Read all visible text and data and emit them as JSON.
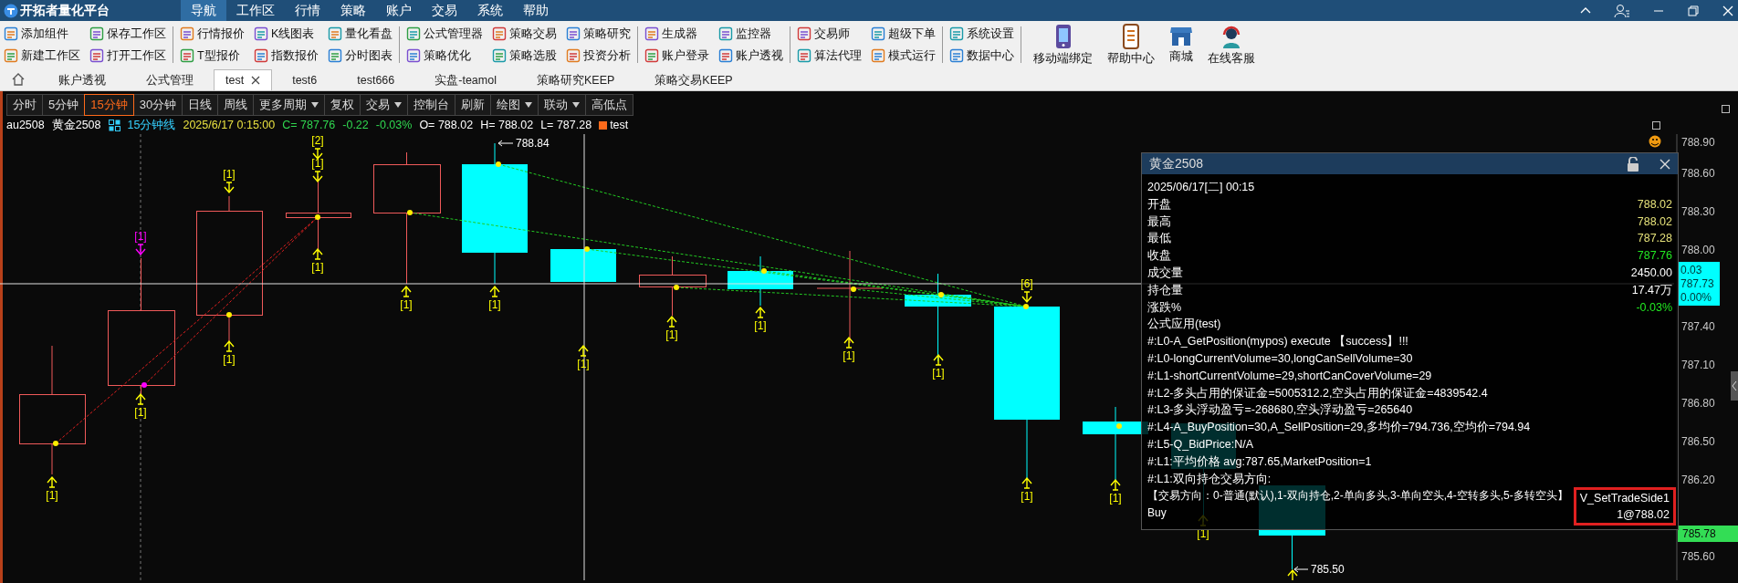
{
  "window": {
    "title": "开拓者量化平台"
  },
  "menu": [
    {
      "label": "导航",
      "selected": true
    },
    {
      "label": "工作区",
      "selected": false
    },
    {
      "label": "行情",
      "selected": false
    },
    {
      "label": "策略",
      "selected": false
    },
    {
      "label": "账户",
      "selected": false
    },
    {
      "label": "交易",
      "selected": false
    },
    {
      "label": "系统",
      "selected": false
    },
    {
      "label": "帮助",
      "selected": false
    }
  ],
  "toolbar": {
    "groups": [
      {
        "items": [
          "添加组件",
          "新建工作区",
          "保存工作区",
          "打开工作区"
        ]
      },
      {
        "items": [
          "行情报价",
          "T型报价",
          "K线图表",
          "指数报价",
          "量化看盘",
          "分时图表"
        ]
      },
      {
        "items": [
          "公式管理器",
          "策略优化",
          "策略交易",
          "策略选股",
          "策略研究",
          "投资分析"
        ]
      },
      {
        "items": [
          "生成器",
          "账户登录",
          "监控器",
          "账户透视"
        ]
      },
      {
        "items": [
          "交易师",
          "算法代理",
          "超级下单",
          "模式运行"
        ]
      },
      {
        "items": [
          "系统设置",
          "数据中心"
        ]
      }
    ],
    "large_buttons": [
      {
        "label": "移动端绑定",
        "kind": "phone"
      },
      {
        "label": "帮助中心",
        "kind": "document"
      },
      {
        "label": "商城",
        "kind": "store"
      },
      {
        "label": "在线客服",
        "kind": "headset"
      }
    ]
  },
  "tabs": [
    {
      "label": "账户透视",
      "selected": false,
      "closable": false
    },
    {
      "label": "公式管理",
      "selected": false,
      "closable": false
    },
    {
      "label": "test",
      "selected": true,
      "closable": true
    },
    {
      "label": "test6",
      "selected": false,
      "closable": false
    },
    {
      "label": "test666",
      "selected": false,
      "closable": false
    },
    {
      "label": "实盘-teamol",
      "selected": false,
      "closable": false
    },
    {
      "label": "策略研究KEEP",
      "selected": false,
      "closable": false
    },
    {
      "label": "策略交易KEEP",
      "selected": false,
      "closable": false
    }
  ],
  "chart_toolbar": [
    {
      "label": "分时",
      "selected": false,
      "dropdown": false
    },
    {
      "label": "5分钟",
      "selected": false,
      "dropdown": false
    },
    {
      "label": "15分钟",
      "selected": true,
      "dropdown": false
    },
    {
      "label": "30分钟",
      "selected": false,
      "dropdown": false
    },
    {
      "label": "日线",
      "selected": false,
      "dropdown": false
    },
    {
      "label": "周线",
      "selected": false,
      "dropdown": false
    },
    {
      "label": "更多周期",
      "selected": false,
      "dropdown": true
    },
    {
      "label": "复权",
      "selected": false,
      "dropdown": false
    },
    {
      "label": "交易",
      "selected": false,
      "dropdown": true
    },
    {
      "label": "控制台",
      "selected": false,
      "dropdown": false
    },
    {
      "label": "刷新",
      "selected": false,
      "dropdown": false
    },
    {
      "label": "绘图",
      "selected": false,
      "dropdown": true
    },
    {
      "label": "联动",
      "selected": false,
      "dropdown": true
    },
    {
      "label": "高低点",
      "selected": false,
      "dropdown": false
    }
  ],
  "quote_line": {
    "symbol": "au2508",
    "name": "黄金2508",
    "period": "15分钟线",
    "time": "2025/6/17 0:15:00",
    "close": "C= 787.76",
    "change": "-0.22",
    "change_pct": "-0.03%",
    "open": "O= 788.02",
    "high": "H= 788.02",
    "low": "L= 787.28",
    "indicator": "test"
  },
  "chart": {
    "price_axis": [
      "788.90",
      "788.60",
      "788.30",
      "788.00",
      "787.40",
      "787.10",
      "786.80",
      "786.50",
      "786.20",
      "785.60"
    ],
    "crosshair_readout": [
      "0.03",
      "787.73",
      "0.00%"
    ],
    "last_price": "785.78",
    "high_mark": "788.84",
    "low_mark": "785.50",
    "signals": [
      {
        "label": "[1]",
        "kind": "buy",
        "color": "#ffff00"
      },
      {
        "label": "[1]",
        "kind": "sell",
        "color": "#ff00ff"
      },
      {
        "label": "[1]",
        "kind": "buy",
        "color": "#ffff00"
      },
      {
        "label": "[1]",
        "kind": "sell",
        "color": "#ffff00"
      },
      {
        "label": "[1]",
        "kind": "buy",
        "color": "#ffff00"
      },
      {
        "label": "[2]",
        "kind": "sell",
        "color": "#ffff00"
      },
      {
        "label": "[1]",
        "kind": "sell",
        "color": "#ffff00"
      },
      {
        "label": "[1]",
        "kind": "buy",
        "color": "#ffff00"
      },
      {
        "label": "[1]",
        "kind": "buy",
        "color": "#ffff00"
      },
      {
        "label": "[1]",
        "kind": "buy",
        "color": "#ffff00"
      },
      {
        "label": "[1]",
        "kind": "buy",
        "color": "#ffff00"
      },
      {
        "label": "[1]",
        "kind": "buy",
        "color": "#ffff00"
      },
      {
        "label": "[1]",
        "kind": "buy",
        "color": "#ffff00"
      },
      {
        "label": "[1]",
        "kind": "buy",
        "color": "#ffff00"
      },
      {
        "label": "[1]",
        "kind": "buy",
        "color": "#ffff00"
      },
      {
        "label": "[6]",
        "kind": "sell",
        "color": "#ffff00"
      },
      {
        "label": "[1]",
        "kind": "buy",
        "color": "#ffff00"
      },
      {
        "label": "[1]",
        "kind": "buy",
        "color": "#ffff00"
      },
      {
        "label": "[1]",
        "kind": "buy",
        "color": "#ffff00"
      }
    ]
  },
  "info_panel": {
    "title": "黄金2508",
    "date": "2025/06/17[二] 00:15",
    "fields": [
      {
        "label": "开盘",
        "value": "788.02",
        "color": "#e6e27a"
      },
      {
        "label": "最高",
        "value": "788.02",
        "color": "#e6e27a"
      },
      {
        "label": "最低",
        "value": "787.28",
        "color": "#e6e27a"
      },
      {
        "label": "收盘",
        "value": "787.76",
        "color": "#22e822"
      },
      {
        "label": "成交量",
        "value": "2450.00",
        "color": "#ffffff"
      },
      {
        "label": "持仓量",
        "value": "17.47万",
        "color": "#ffffff"
      },
      {
        "label": "涨跌%",
        "value": "-0.03%",
        "color": "#22e822"
      }
    ],
    "log": [
      "公式应用(test)",
      "#:L0-A_GetPosition(mypos) execute 【success】!!!",
      "#:L0-longCurrentVolume=30,longCanSellVolume=30",
      "#:L1-shortCurrentVolume=29,shortCanCoverVolume=29",
      "#:L2-多头占用的保证金=5005312.2,空头占用的保证金=4839542.4",
      "#:L3-多头浮动盈亏=-268680,空头浮动盈亏=265640",
      "#:L4-A_BuyPosition=30,A_SellPosition=29,多均价=794.736,空均价=794.94",
      "#:L5-Q_BidPrice:N/A",
      "#:L1:平均价格 avg:787.65,MarketPosition=1",
      "#:L1:双向持仓交易方向:"
    ],
    "trade_side_note": "【交易方向：0-普通(默认),1-双向持仓,2-单向多头,3-单向空头,4-空转多头,5-多转空头】",
    "trade_side_value": "V_SetTradeSide1",
    "order_side": "Buy",
    "order_fill": "1@788.02"
  }
}
